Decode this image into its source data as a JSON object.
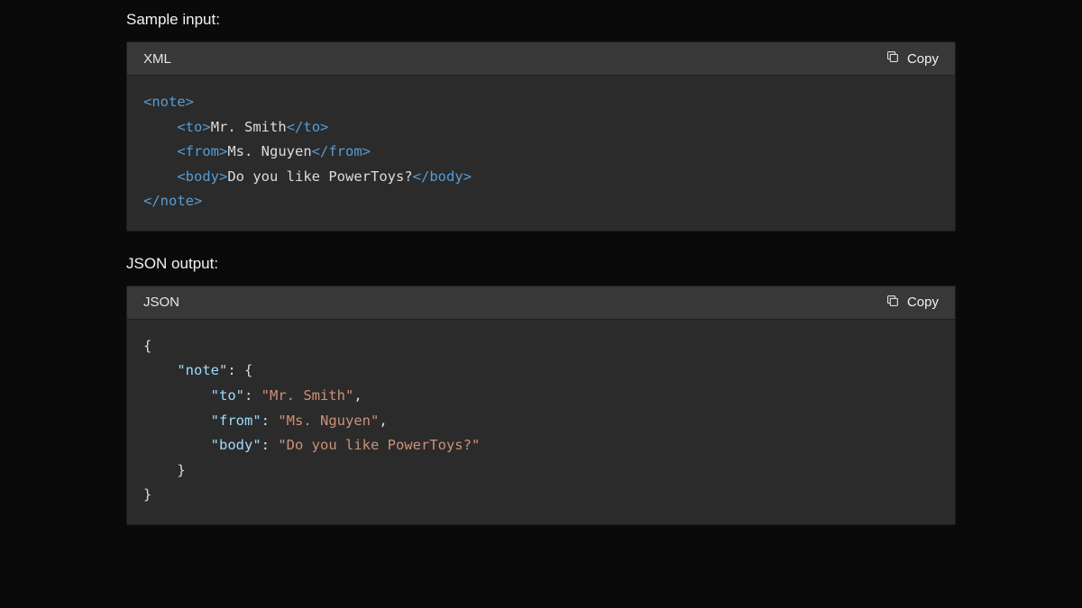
{
  "section1": {
    "heading": "Sample input:",
    "lang": "XML",
    "copy": "Copy",
    "xml": {
      "root": "note",
      "to_tag": "to",
      "to_val": "Mr. Smith",
      "from_tag": "from",
      "from_val": "Ms. Nguyen",
      "body_tag": "body",
      "body_val": "Do you like PowerToys?"
    }
  },
  "section2": {
    "heading": "JSON output:",
    "lang": "JSON",
    "copy": "Copy",
    "json": {
      "root_key": "\"note\"",
      "to_key": "\"to\"",
      "to_val": "\"Mr. Smith\"",
      "from_key": "\"from\"",
      "from_val": "\"Ms. Nguyen\"",
      "body_key": "\"body\"",
      "body_val": "\"Do you like PowerToys?\""
    }
  }
}
